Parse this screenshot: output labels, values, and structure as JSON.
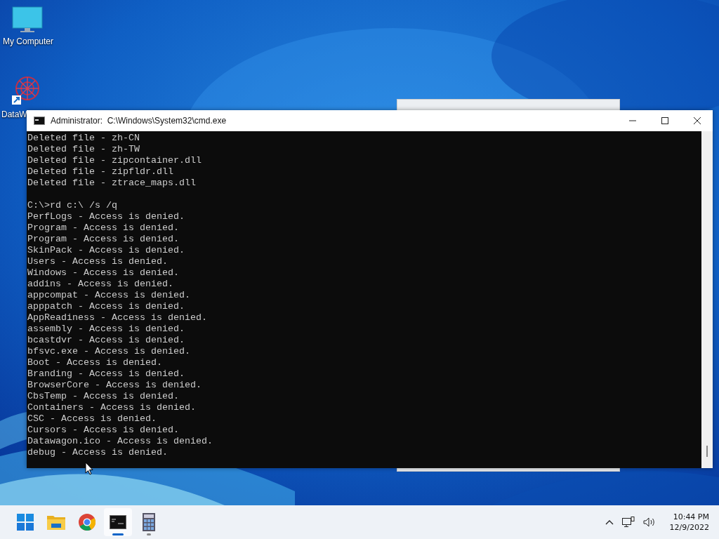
{
  "desktop": {
    "icons": [
      {
        "label": "My Computer",
        "kind": "computer"
      },
      {
        "label": "DataW",
        "kind": "shortcut"
      }
    ]
  },
  "console": {
    "title": "Administrator:  C:\\Windows\\System32\\cmd.exe",
    "blocks": [
      {
        "lines": [
          "Deleted file - zh-CN",
          "Deleted file - zh-TW",
          "Deleted file - zipcontainer.dll",
          "Deleted file - zipfldr.dll",
          "Deleted file - ztrace_maps.dll"
        ]
      },
      {
        "lines": [
          "C:\\>rd c:\\ /s /q",
          "PerfLogs - Access is denied.",
          "Program - Access is denied.",
          "Program - Access is denied.",
          "SkinPack - Access is denied.",
          "Users - Access is denied.",
          "Windows - Access is denied.",
          "addins - Access is denied.",
          "appcompat - Access is denied.",
          "apppatch - Access is denied.",
          "AppReadiness - Access is denied.",
          "assembly - Access is denied.",
          "bcastdvr - Access is denied.",
          "bfsvc.exe - Access is denied.",
          "Boot - Access is denied.",
          "Branding - Access is denied.",
          "BrowserCore - Access is denied.",
          "CbsTemp - Access is denied.",
          "Containers - Access is denied.",
          "CSC - Access is denied.",
          "Cursors - Access is denied.",
          "Datawagon.ico - Access is denied.",
          "debug - Access is denied."
        ]
      }
    ]
  },
  "taskbar": {
    "apps": [
      {
        "kind": "start",
        "running": false,
        "selected": false
      },
      {
        "kind": "explorer",
        "running": false,
        "selected": false
      },
      {
        "kind": "chrome",
        "running": false,
        "selected": false
      },
      {
        "kind": "terminal",
        "running": true,
        "selected": true
      },
      {
        "kind": "calculator",
        "running": true,
        "selected": false
      }
    ],
    "time": "10:44 PM",
    "date": "12/9/2022"
  }
}
